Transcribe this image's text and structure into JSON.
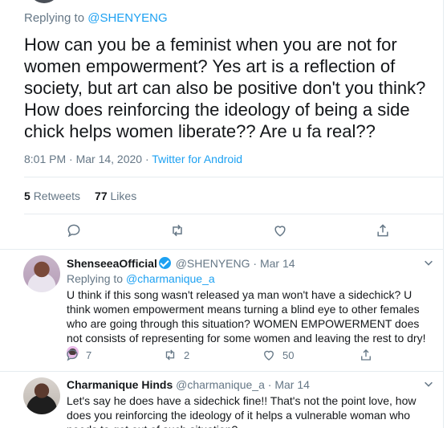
{
  "main_tweet": {
    "replying_prefix": "Replying to",
    "replying_handle": "@SHENYENG",
    "text": "How can you be a feminist when you are not for women empowerment? Yes art is a reflection of society, but art can also be positive don't you think? How does reinforcing the ideology of being a side chick helps women liberate?? Are u fa real??",
    "timestamp": "8:01 PM · Mar 14, 2020 · ",
    "source": "Twitter for Android",
    "retweets_count": "5",
    "retweets_label": "Retweets",
    "likes_count": "77",
    "likes_label": "Likes"
  },
  "replies": [
    {
      "name": "ShenseeaOfficial",
      "verified": true,
      "handle": "@SHENYENG",
      "date": "· Mar 14",
      "replying_prefix": "Replying to",
      "replying_handle": "@charmanique_a",
      "text": "U think if this song wasn't released ya man won't have a sidechick? U think women empowerment means turning a blind eye to other females who are going through this situation? WOMEN EMPOWERMENT does not consists of representing for some women and leaving the rest to dry!",
      "reply_count": "7",
      "retweet_count": "2",
      "like_count": "50"
    },
    {
      "name": "Charmanique Hinds",
      "handle": "@charmanique_a",
      "date": "· Mar 14",
      "text": "Let's say he does have a sidechick fine!! That's not the point love, how does you reinforcing the ideology of it helps a vulnerable woman who needs to get out of such situation?"
    }
  ],
  "colors": {
    "accent": "#1da1f2",
    "secondary_text": "#657786",
    "primary_text": "#14171a",
    "divider": "#e6ecf0"
  },
  "icons": [
    "reply-icon",
    "retweet-icon",
    "like-icon",
    "share-icon",
    "chevron-down-icon",
    "verified-badge-icon",
    "face-palm-emoji"
  ]
}
